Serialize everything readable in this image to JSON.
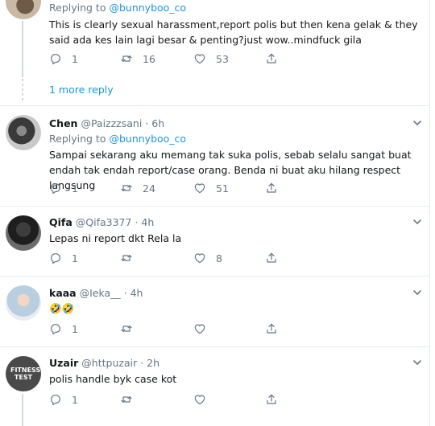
{
  "tweets": [
    {
      "replying_prefix": "Replying to",
      "replying_handle": "@bunnyboo_co",
      "text": "This is clearly sexual harassment,report polis but then kena gelak & they said ada kes lain lagi besar & penting?just wow..mindfuck gila",
      "reply_count": "1",
      "retweet_count": "16",
      "like_count": "53"
    },
    {
      "name": "Chen",
      "handle": "@Paizzzsani",
      "time": "· 6h",
      "replying_prefix": "Replying to",
      "replying_handle": "@bunnyboo_co",
      "text": "Sampai sekarang aku memang tak suka polis, sebab selalu sangat buat endah tak endah report/case orang. Benda ni buat aku hilang respect langsung",
      "reply_count": "1",
      "retweet_count": "24",
      "like_count": "51"
    },
    {
      "name": "Qifa",
      "handle": "@Qifa3377",
      "time": "· 4h",
      "text": "Lepas ni report dkt Rela la",
      "reply_count": "1",
      "retweet_count": "",
      "like_count": "8"
    },
    {
      "name": "kaaa",
      "handle": "@Ieka__",
      "time": "· 4h",
      "text": "🤣🤣",
      "reply_count": "1",
      "retweet_count": "",
      "like_count": ""
    },
    {
      "name": "Uzair",
      "handle": "@httpuzair",
      "time": "· 2h",
      "text": "polis handle byk case kot",
      "reply_count": "1",
      "retweet_count": "",
      "like_count": ""
    }
  ],
  "more_replies": "1 more reply",
  "avatar_text": {
    "uzair": "FITNESS TEST"
  },
  "colors": {
    "link": "#1b95e0",
    "secondary": "#657786",
    "separator": "#e6ecf0",
    "text": "#14171a"
  },
  "icons": [
    "reply-icon",
    "retweet-icon",
    "like-icon",
    "share-icon",
    "chevron-down-icon"
  ]
}
